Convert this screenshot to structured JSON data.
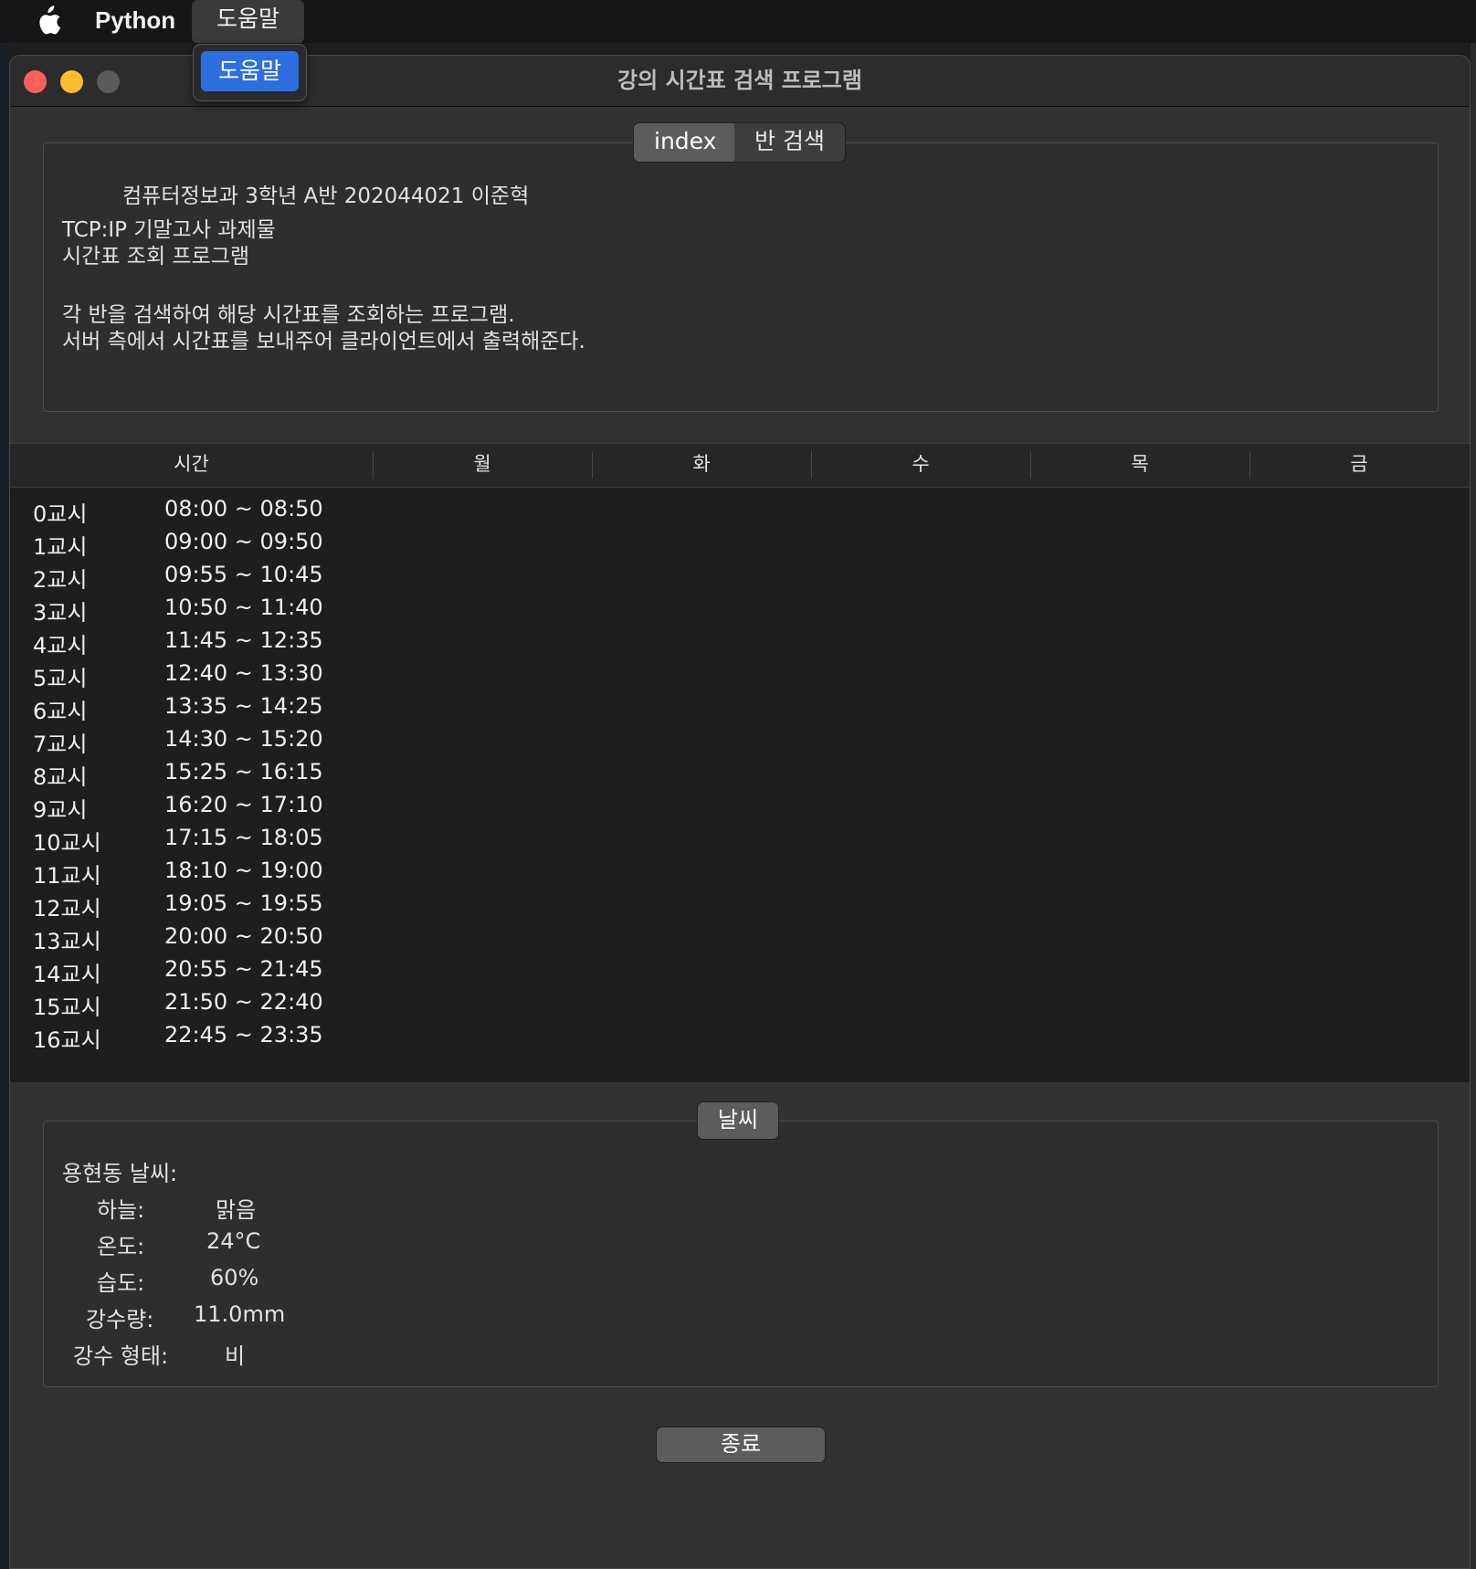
{
  "menubar": {
    "app_name": "Python",
    "help_menu": "도움말",
    "dropdown_item": "도움말"
  },
  "window": {
    "title": "강의 시간표 검색 프로그램"
  },
  "tabs": [
    {
      "label": "index",
      "active": true
    },
    {
      "label": "반 검색",
      "active": false
    }
  ],
  "info": {
    "line1": "컴퓨터정보과 3학년 A반 202044021 이준혁",
    "line2": "TCP:IP 기말고사 과제물",
    "line3": "시간표 조회 프로그램",
    "line4": "각 반을 검색하여 해당 시간표를 조회하는 프로그램.",
    "line5": "서버 측에서 시간표를 보내주어 클라이언트에서 출력해준다."
  },
  "table": {
    "headers": [
      "시간",
      "월",
      "화",
      "수",
      "목",
      "금"
    ],
    "rows": [
      {
        "period": "0교시",
        "time": "08:00 ~ 08:50"
      },
      {
        "period": "1교시",
        "time": "09:00 ~ 09:50"
      },
      {
        "period": "2교시",
        "time": "09:55 ~ 10:45"
      },
      {
        "period": "3교시",
        "time": "10:50 ~ 11:40"
      },
      {
        "period": "4교시",
        "time": "11:45 ~ 12:35"
      },
      {
        "period": "5교시",
        "time": "12:40 ~ 13:30"
      },
      {
        "period": "6교시",
        "time": "13:35 ~ 14:25"
      },
      {
        "period": "7교시",
        "time": "14:30 ~ 15:20"
      },
      {
        "period": "8교시",
        "time": "15:25 ~ 16:15"
      },
      {
        "period": "9교시",
        "time": "16:20 ~ 17:10"
      },
      {
        "period": "10교시",
        "time": "17:15 ~ 18:05"
      },
      {
        "period": "11교시",
        "time": "18:10 ~ 19:00"
      },
      {
        "period": "12교시",
        "time": "19:05 ~ 19:55"
      },
      {
        "period": "13교시",
        "time": "20:00 ~ 20:50"
      },
      {
        "period": "14교시",
        "time": "20:55 ~ 21:45"
      },
      {
        "period": "15교시",
        "time": "21:50 ~ 22:40"
      },
      {
        "period": "16교시",
        "time": "22:45 ~ 23:35"
      }
    ]
  },
  "weather": {
    "group_label": "날씨",
    "location": "용현동 날씨:",
    "items": [
      {
        "label": "하늘:",
        "value": "맑음"
      },
      {
        "label": "온도:",
        "value": "24°C"
      },
      {
        "label": "습도:",
        "value": "60%"
      },
      {
        "label": "강수량:",
        "value": "11.0mm"
      },
      {
        "label": "강수 형태:",
        "value": "비"
      }
    ]
  },
  "exit_button": "종료",
  "colors": {
    "accent": "#2d6fe0",
    "close": "#fe5f57",
    "minimize": "#febc2e"
  }
}
